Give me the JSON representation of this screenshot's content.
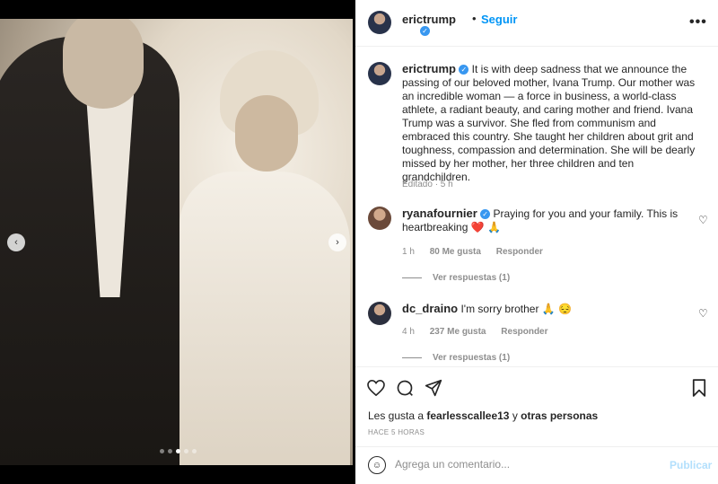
{
  "post": {
    "author": "erictrump",
    "follow_label": "Seguir",
    "separator": "•",
    "more_label": "•••",
    "verified_glyph": "✓",
    "caption": "It is with deep sadness that we announce the passing of our beloved mother, Ivana Trump. Our mother was an incredible woman — a force in business, a world-class athlete, a radiant beauty, and caring mother and friend. Ivana Trump was a survivor. She fled from communism and embraced this country. She taught her children about grit and toughness, compassion and determination. She will be dearly missed by her mother, her three children and ten grandchildren.",
    "caption_meta": "Editado · 5 h",
    "media_dots": 5,
    "active_dot": 2
  },
  "comments": [
    {
      "user": "ryanafournier",
      "verified": true,
      "text": "Praying for you and your family. This is heartbreaking",
      "emoji": "❤️ 🙏",
      "age": "1 h",
      "likes": "80 Me gusta",
      "reply_label": "Responder",
      "view_replies": "Ver respuestas (1)"
    },
    {
      "user": "dc_draino",
      "verified": false,
      "text": "I'm sorry brother",
      "emoji": "🙏 😔",
      "age": "4 h",
      "likes": "237 Me gusta",
      "reply_label": "Responder",
      "view_replies": "Ver respuestas (1)"
    }
  ],
  "actions": {
    "like_icon": "heart-icon",
    "comment_icon": "comment-icon",
    "share_icon": "share-icon",
    "save_icon": "bookmark-icon"
  },
  "likes_summary": {
    "prefix": "Les gusta a",
    "user": "fearlesscallee13",
    "connector": "y",
    "others": "otras personas"
  },
  "timestamp": "HACE 5 HORAS",
  "comment_box": {
    "placeholder": "Agrega un comentario...",
    "publish_label": "Publicar"
  },
  "colors": {
    "accent": "#0095f6",
    "publish_disabled": "#b2dffc",
    "like_red": "#ed4956"
  }
}
